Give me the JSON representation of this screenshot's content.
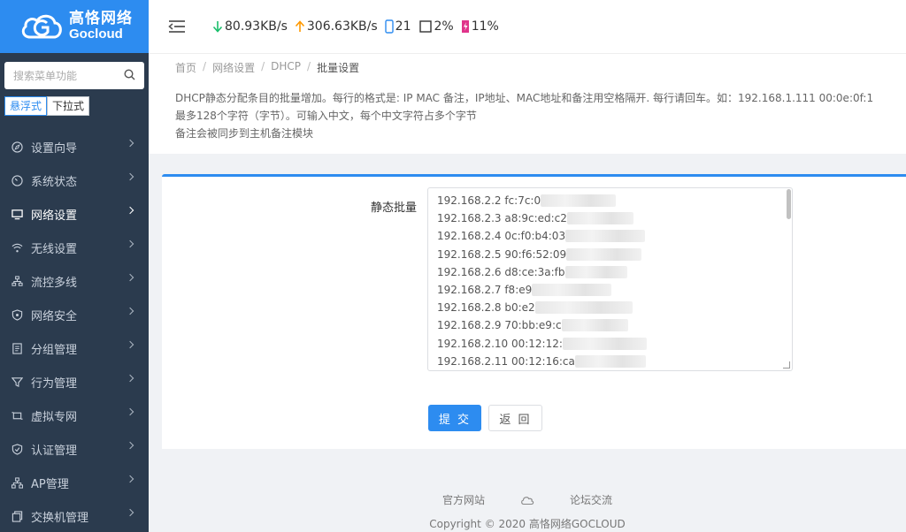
{
  "brand": {
    "name_cn": "高恪网络",
    "name_en": "Gocloud",
    "color": "#2d8cf0"
  },
  "header": {
    "download": "80.93KB/s",
    "upload": "306.63KB/s",
    "connections": "21",
    "cpu": "2%",
    "memory": "11%"
  },
  "sidebar": {
    "search_placeholder": "搜索菜单功能",
    "mode_float": "悬浮式",
    "mode_dropdown": "下拉式",
    "items": [
      {
        "label": "设置向导",
        "icon": "compass-icon"
      },
      {
        "label": "系统状态",
        "icon": "gauge-icon"
      },
      {
        "label": "网络设置",
        "icon": "monitor-icon",
        "active": true
      },
      {
        "label": "无线设置",
        "icon": "wifi-icon"
      },
      {
        "label": "流控多线",
        "icon": "network-icon"
      },
      {
        "label": "网络安全",
        "icon": "shield-icon"
      },
      {
        "label": "分组管理",
        "icon": "document-icon"
      },
      {
        "label": "行为管理",
        "icon": "funnel-icon"
      },
      {
        "label": "虚拟专网",
        "icon": "vpn-icon"
      },
      {
        "label": "认证管理",
        "icon": "check-shield-icon"
      },
      {
        "label": "AP管理",
        "icon": "tree-icon"
      },
      {
        "label": "交换机管理",
        "icon": "copy-icon"
      }
    ]
  },
  "breadcrumb": [
    "首页",
    "网络设置",
    "DHCP",
    "批量设置"
  ],
  "description": [
    "DHCP静态分配条目的批量增加。每行的格式是: IP MAC 备注，IP地址、MAC地址和备注用空格隔开. 每行请回车。如：192.168.1.111 00:0e:0f:1",
    "最多128个字符（字节）。可输入中文，每个中文字符占多个字节",
    "备注会被同步到主机备注模块"
  ],
  "form": {
    "label": "静态批量",
    "lines": [
      "192.168.2.2 fc:7c:0",
      "192.168.2.3 a8:9c:ed:c2",
      "192.168.2.4 0c:f0:b4:03",
      "192.168.2.5 90:f6:52:09",
      "192.168.2.6 d8:ce:3a:fb",
      "192.168.2.7 f8:e9",
      "192.168.2.8 b0:e2",
      "192.168.2.9 70:bb:e9:c",
      "192.168.2.10 00:12:12:",
      "192.168.2.11 00:12:16:ca"
    ],
    "submit_label": "提 交",
    "back_label": "返 回"
  },
  "footer": {
    "official_site": "官方网站",
    "forum": "论坛交流",
    "copyright_prefix": "Copyright",
    "copyright_rest": "2020 高恪网络GOCLOUD"
  }
}
